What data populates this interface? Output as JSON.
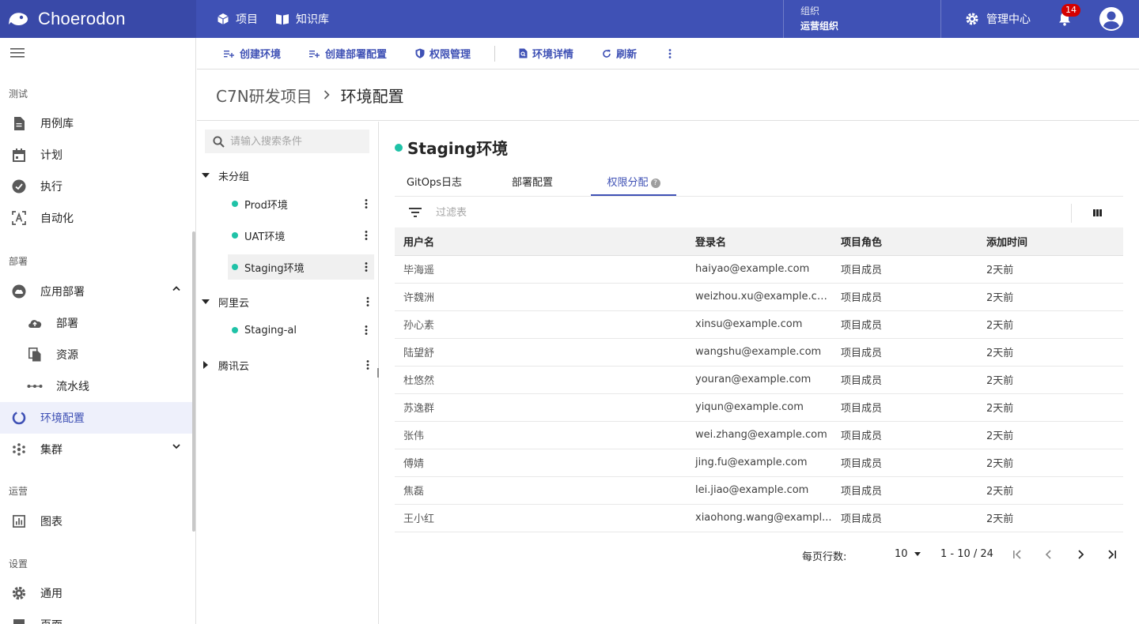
{
  "app": {
    "brand": "Choerodon",
    "nav": [
      {
        "label": "项目",
        "icon": "cube-icon"
      },
      {
        "label": "知识库",
        "icon": "book-icon"
      }
    ],
    "org_label": "组织",
    "org_value": "运营组织",
    "admin_label": "管理中心",
    "notification_count": "14",
    "accent": "#3f51b5"
  },
  "sidebar": {
    "sections": [
      {
        "title": "测试",
        "items": [
          {
            "label": "用例库",
            "icon": "document-icon"
          },
          {
            "label": "计划",
            "icon": "calendar-icon"
          },
          {
            "label": "执行",
            "icon": "check-circle-icon"
          },
          {
            "label": "自动化",
            "icon": "automation-icon"
          }
        ]
      },
      {
        "title": "部署",
        "items": [
          {
            "label": "应用部署",
            "icon": "cloud-icon",
            "expanded": true
          },
          {
            "label": "部署",
            "icon": "cloud-upload-icon",
            "sub": true
          },
          {
            "label": "资源",
            "icon": "copy-icon",
            "sub": true
          },
          {
            "label": "流水线",
            "icon": "pipeline-icon",
            "sub": true
          },
          {
            "label": "环境配置",
            "icon": "env-icon",
            "active": true
          },
          {
            "label": "集群",
            "icon": "cluster-icon",
            "expandable": true
          }
        ]
      },
      {
        "title": "运营",
        "items": [
          {
            "label": "图表",
            "icon": "chart-icon"
          }
        ]
      },
      {
        "title": "设置",
        "items": [
          {
            "label": "通用",
            "icon": "gear-icon"
          },
          {
            "label": "页面",
            "icon": "page-icon"
          }
        ]
      }
    ]
  },
  "toolbar": {
    "create_env": "创建环境",
    "create_deploy_config": "创建部署配置",
    "permission": "权限管理",
    "env_detail": "环境详情",
    "refresh": "刷新"
  },
  "breadcrumb": {
    "parent": "C7N研发项目",
    "current": "环境配置"
  },
  "tree": {
    "search_placeholder": "请输入搜索条件",
    "groups": [
      {
        "label": "未分组",
        "expanded": true,
        "nodes": [
          "Prod环境",
          "UAT环境",
          "Staging环境"
        ]
      },
      {
        "label": "阿里云",
        "expanded": true,
        "nodes": [
          "Staging-al"
        ]
      },
      {
        "label": "腾讯云",
        "expanded": false,
        "nodes": []
      }
    ],
    "selected": "Staging环境"
  },
  "env": {
    "title": "Staging环境",
    "status_color": "#1fc2a7",
    "tabs": [
      "GitOps日志",
      "部署配置",
      "权限分配"
    ],
    "active_tab": "权限分配"
  },
  "filter": {
    "placeholder": "过滤表"
  },
  "table": {
    "columns": [
      "用户名",
      "登录名",
      "项目角色",
      "添加时间"
    ],
    "rows": [
      [
        "毕海遥",
        "haiyao@example.com",
        "项目成员",
        "2天前"
      ],
      [
        "许魏洲",
        "weizhou.xu@example.com",
        "项目成员",
        "2天前"
      ],
      [
        "孙心素",
        "xinsu@example.com",
        "项目成员",
        "2天前"
      ],
      [
        "陆望舒",
        "wangshu@example.com",
        "项目成员",
        "2天前"
      ],
      [
        "杜悠然",
        "youran@example.com",
        "项目成员",
        "2天前"
      ],
      [
        "苏逸群",
        "yiqun@example.com",
        "项目成员",
        "2天前"
      ],
      [
        "张伟",
        "wei.zhang@example.com",
        "项目成员",
        "2天前"
      ],
      [
        "傅婧",
        "jing.fu@example.com",
        "项目成员",
        "2天前"
      ],
      [
        "焦磊",
        "lei.jiao@example.com",
        "项目成员",
        "2天前"
      ],
      [
        "王小红",
        "xiaohong.wang@exampl...",
        "项目成员",
        "2天前"
      ]
    ]
  },
  "pagination": {
    "rows_per_page_label": "每页行数:",
    "page_size": "10",
    "range": "1 - 10 / 24"
  }
}
